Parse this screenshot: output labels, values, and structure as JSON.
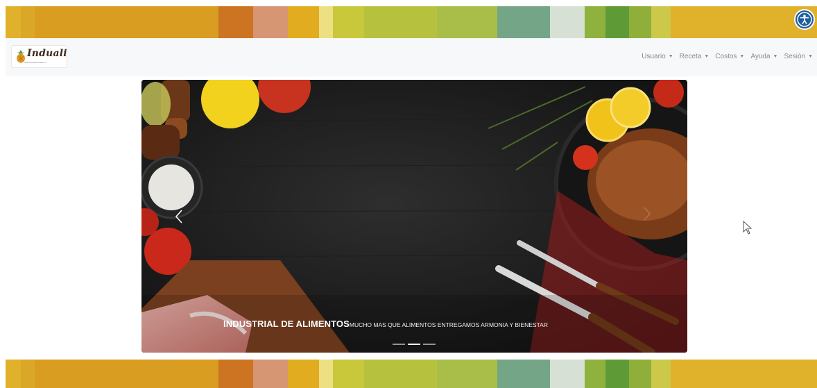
{
  "stripe_colors": [
    "#e0b12b",
    "#dba728",
    "#d99d22",
    "#d99d22",
    "#cc7422",
    "#d69673",
    "#e1ac1f",
    "#ede083",
    "#c9c83b",
    "#b6c23e",
    "#a9be48",
    "#74a587",
    "#d6e0d4",
    "#8fb13d",
    "#5e9b36",
    "#8fae3a",
    "#ccc94a",
    "#e0b12b"
  ],
  "accessibility": {
    "icon": "accessibility-icon"
  },
  "logo": {
    "brand": "Induali",
    "tagline": "SOLUCIONES PARA TI"
  },
  "nav": {
    "items": [
      {
        "label": "Usuario"
      },
      {
        "label": "Receta"
      },
      {
        "label": "Costos"
      },
      {
        "label": "Ayuda"
      },
      {
        "label": "Sesión"
      }
    ]
  },
  "carousel": {
    "caption_title": "INDUSTRIAL DE ALIMENTOS",
    "caption_text": "MUCHO MAS QUE ALIMENTOS ENTREGAMOS ARMONIA Y BIENESTAR",
    "prev_icon": "chevron-left-icon",
    "next_icon": "chevron-right-icon",
    "indicators": 3,
    "active_indicator": 2
  }
}
